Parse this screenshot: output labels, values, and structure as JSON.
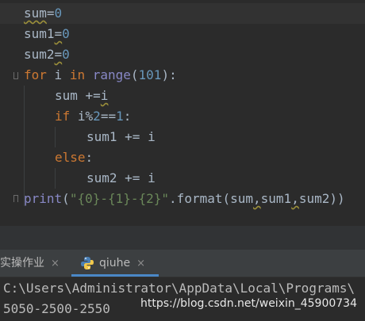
{
  "editor": {
    "lines": [
      {
        "parts": [
          "sum",
          "=",
          "0"
        ]
      },
      {
        "parts": [
          "sum1",
          "=",
          "0"
        ]
      },
      {
        "parts": [
          "sum2",
          "=",
          "0"
        ]
      },
      {
        "parts": [
          "for",
          " i ",
          "in",
          " ",
          "range",
          "(",
          "101",
          "):"
        ]
      },
      {
        "parts": [
          "sum +=",
          "i"
        ]
      },
      {
        "parts": [
          "if",
          " i%",
          "2",
          "==",
          "1",
          ":"
        ]
      },
      {
        "parts": [
          "sum1 += i"
        ]
      },
      {
        "parts": [
          "else",
          ":"
        ]
      },
      {
        "parts": [
          "sum2 += i"
        ]
      },
      {
        "parts": [
          "print",
          "(",
          "\"{0}-{1}-{2}\"",
          ".format(sum",
          ",",
          "sum1",
          ",",
          "sum2))"
        ]
      }
    ]
  },
  "tabs": [
    {
      "label": "实操作业",
      "close": "×"
    },
    {
      "label": "qiuhe",
      "close": "×"
    }
  ],
  "console": {
    "path_line": "C:\\Users\\Administrator\\AppData\\Local\\Programs\\",
    "output_line": "5050-2500-2550"
  },
  "watermark": "https://blog.csdn.net/weixin_45900734",
  "colors": {
    "keyword": "#cc7832",
    "number": "#6897bb",
    "builtin": "#8888c6",
    "string": "#6a8759",
    "text": "#a9b7c6",
    "tab_underline": "#4a88c7"
  }
}
